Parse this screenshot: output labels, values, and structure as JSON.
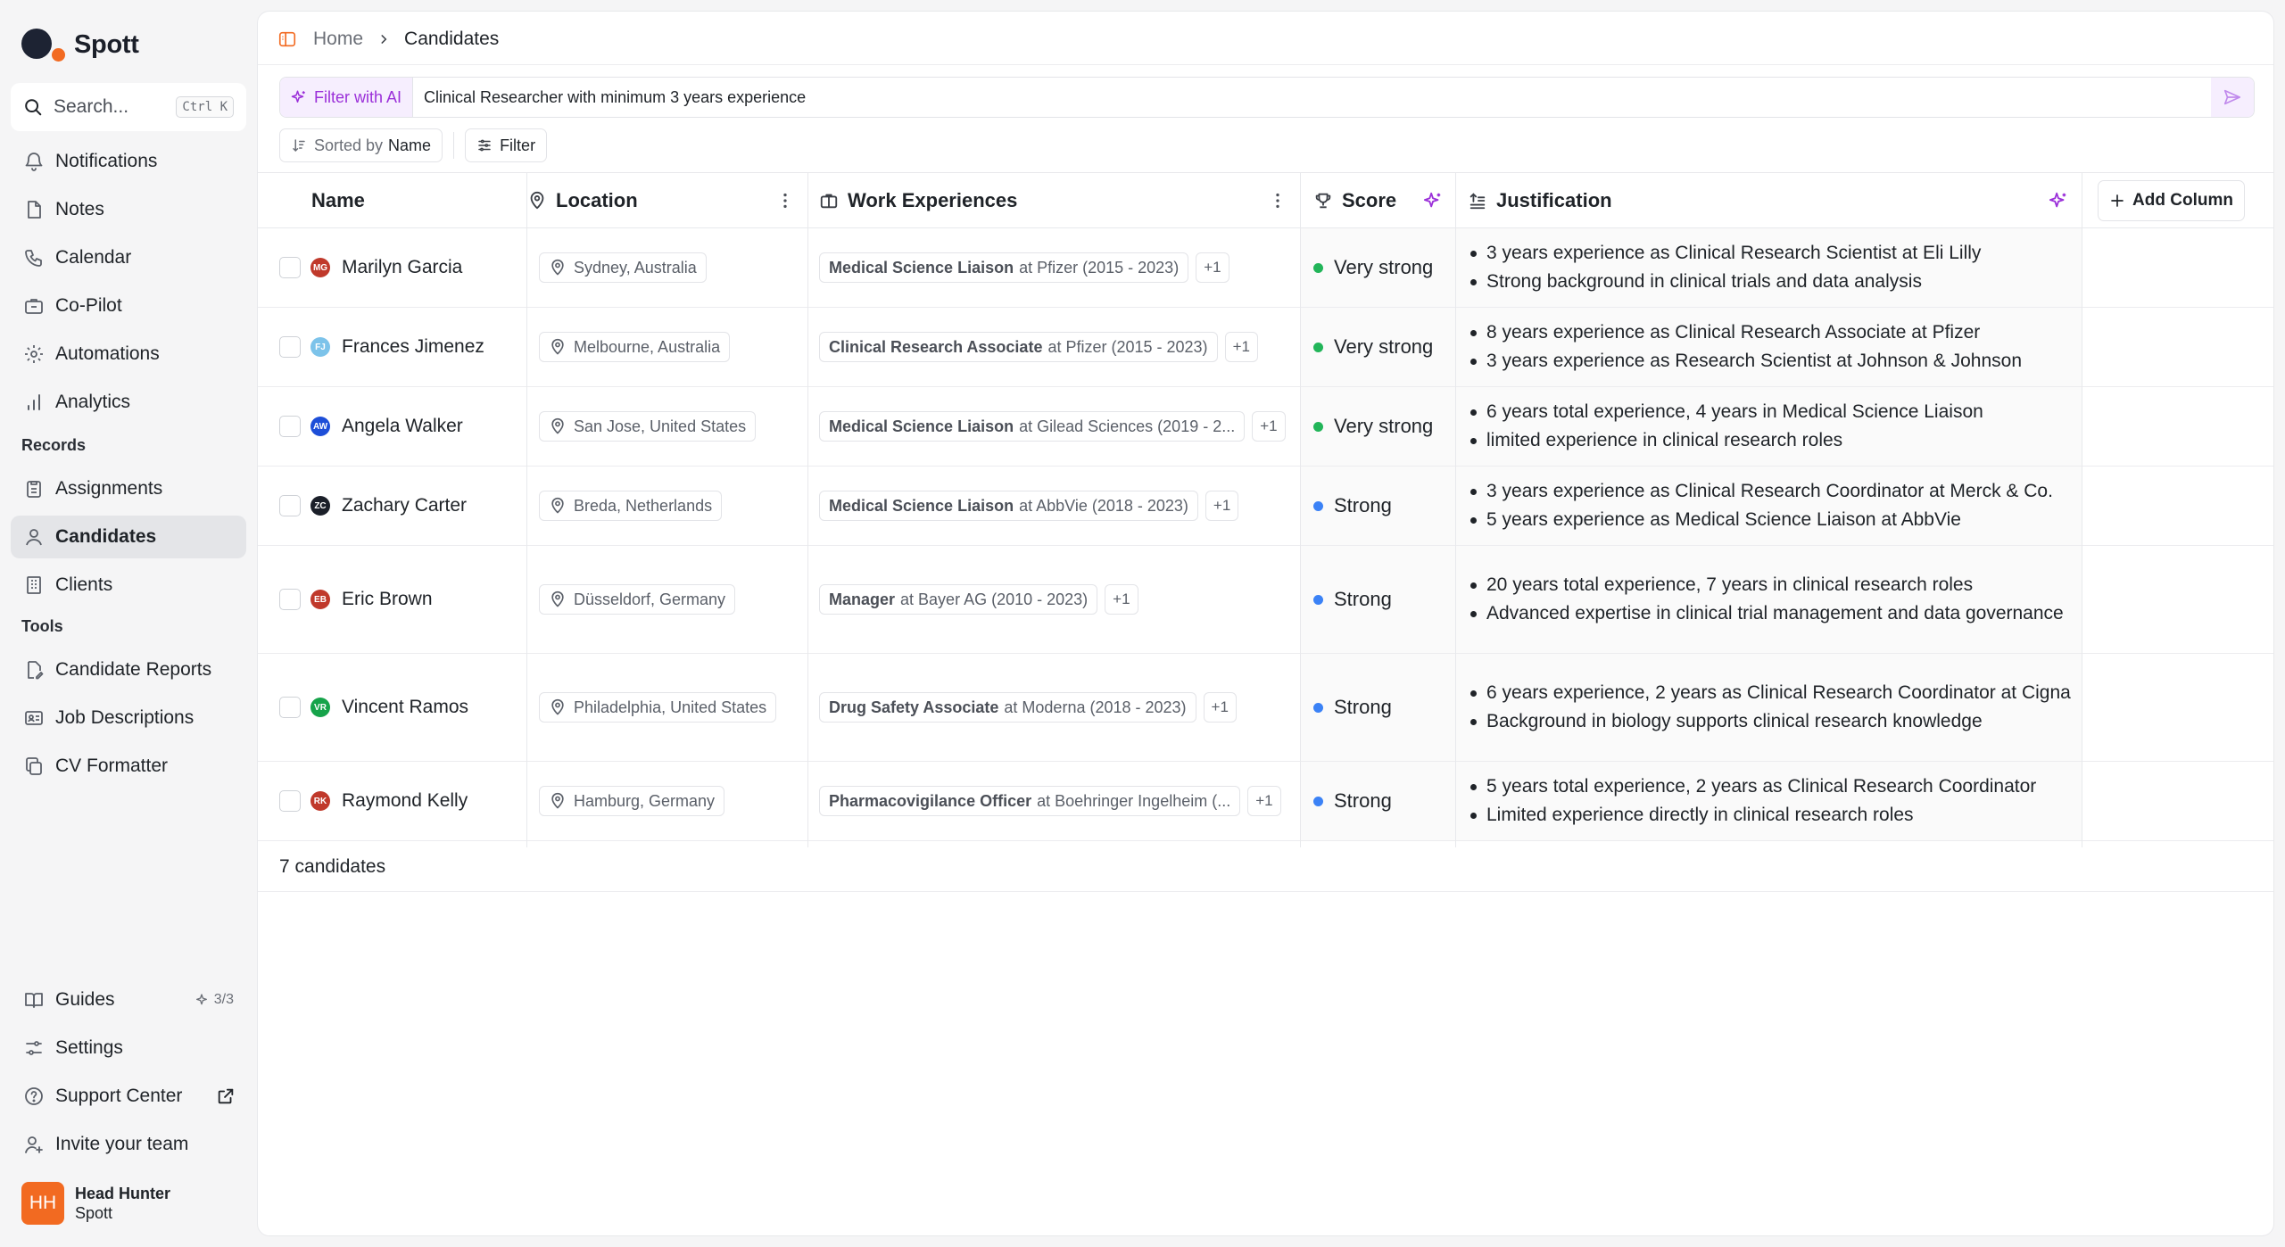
{
  "app": {
    "name": "Spott"
  },
  "search": {
    "placeholder": "Search...",
    "shortcut": "Ctrl K"
  },
  "nav": {
    "primary": [
      "Notifications",
      "Notes",
      "Calendar",
      "Co-Pilot",
      "Automations",
      "Analytics"
    ],
    "records_label": "Records",
    "records": [
      "Assignments",
      "Candidates",
      "Clients"
    ],
    "tools_label": "Tools",
    "tools": [
      "Candidate Reports",
      "Job Descriptions",
      "CV Formatter"
    ],
    "bottom": [
      "Guides",
      "Settings",
      "Support Center",
      "Invite your team"
    ],
    "guides_progress": "3/3",
    "active": "Candidates"
  },
  "user": {
    "initials": "HH",
    "name": "Head Hunter",
    "org": "Spott"
  },
  "breadcrumb": {
    "home": "Home",
    "current": "Candidates"
  },
  "ai_filter": {
    "label": "Filter with AI",
    "query": "Clinical Researcher with minimum 3 years experience"
  },
  "toolbar": {
    "sorted_prefix": "Sorted by",
    "sorted_field": "Name",
    "filter_label": "Filter"
  },
  "columns": {
    "name": "Name",
    "location": "Location",
    "work": "Work Experiences",
    "score": "Score",
    "justification": "Justification",
    "add_column": "Add Column"
  },
  "colors": {
    "very_strong": "#22b559",
    "strong": "#3b82f6",
    "accent": "#9b30d9"
  },
  "candidates": [
    {
      "initials": "MG",
      "avatar_color": "#c0392b",
      "name": "Marilyn Garcia",
      "location": "Sydney, Australia",
      "work_title": "Medical Science Liaison",
      "work_rest": "at Pfizer (2015 - 2023)",
      "more": "+1",
      "score": "Very strong",
      "score_color": "#22b559",
      "justification": [
        "3 years experience as Clinical Research Scientist at Eli Lilly",
        "Strong background in clinical trials and data analysis"
      ]
    },
    {
      "initials": "FJ",
      "avatar_color": "#7cc3ea",
      "name": "Frances Jimenez",
      "location": "Melbourne, Australia",
      "work_title": "Clinical Research Associate",
      "work_rest": "at Pfizer (2015 - 2023)",
      "more": "+1",
      "score": "Very strong",
      "score_color": "#22b559",
      "justification": [
        "8 years experience as Clinical Research Associate at Pfizer",
        "3 years experience as Research Scientist at Johnson & Johnson"
      ]
    },
    {
      "initials": "AW",
      "avatar_color": "#1d4ed8",
      "name": "Angela Walker",
      "location": "San Jose, United States",
      "work_title": "Medical Science Liaison",
      "work_rest": "at Gilead Sciences (2019 - 2...",
      "more": "+1",
      "score": "Very strong",
      "score_color": "#22b559",
      "justification": [
        "6 years total experience, 4 years in Medical Science Liaison",
        "limited experience in clinical research roles"
      ]
    },
    {
      "initials": "ZC",
      "avatar_color": "#1b1f29",
      "name": "Zachary Carter",
      "location": "Breda, Netherlands",
      "work_title": "Medical Science Liaison",
      "work_rest": "at AbbVie (2018 - 2023)",
      "more": "+1",
      "score": "Strong",
      "score_color": "#3b82f6",
      "justification": [
        "3 years experience as Clinical Research Coordinator at Merck & Co.",
        "5 years experience as Medical Science Liaison at AbbVie"
      ]
    },
    {
      "initials": "EB",
      "avatar_color": "#c0392b",
      "name": "Eric Brown",
      "location": "Düsseldorf, Germany",
      "work_title": "Manager",
      "work_rest": "at Bayer AG (2010 - 2023)",
      "more": "+1",
      "score": "Strong",
      "score_color": "#3b82f6",
      "justification": [
        "20 years total experience, 7 years in clinical research roles",
        "Advanced expertise in clinical trial management and data governance"
      ]
    },
    {
      "initials": "VR",
      "avatar_color": "#16a34a",
      "name": "Vincent Ramos",
      "location": "Philadelphia, United States",
      "work_title": "Drug Safety Associate",
      "work_rest": "at Moderna (2018 - 2023)",
      "more": "+1",
      "score": "Strong",
      "score_color": "#3b82f6",
      "justification": [
        "6 years experience, 2 years as Clinical Research Coordinator at Cigna",
        "Background in biology supports clinical research knowledge"
      ]
    },
    {
      "initials": "RK",
      "avatar_color": "#c0392b",
      "name": "Raymond Kelly",
      "location": "Hamburg, Germany",
      "work_title": "Pharmacovigilance Officer",
      "work_rest": "at Boehringer Ingelheim (...",
      "more": "+1",
      "score": "Strong",
      "score_color": "#3b82f6",
      "justification": [
        "5 years total experience, 2 years as Clinical Research Coordinator",
        "Limited experience directly in clinical research roles"
      ]
    }
  ],
  "footer": {
    "count_label": "7 candidates"
  }
}
